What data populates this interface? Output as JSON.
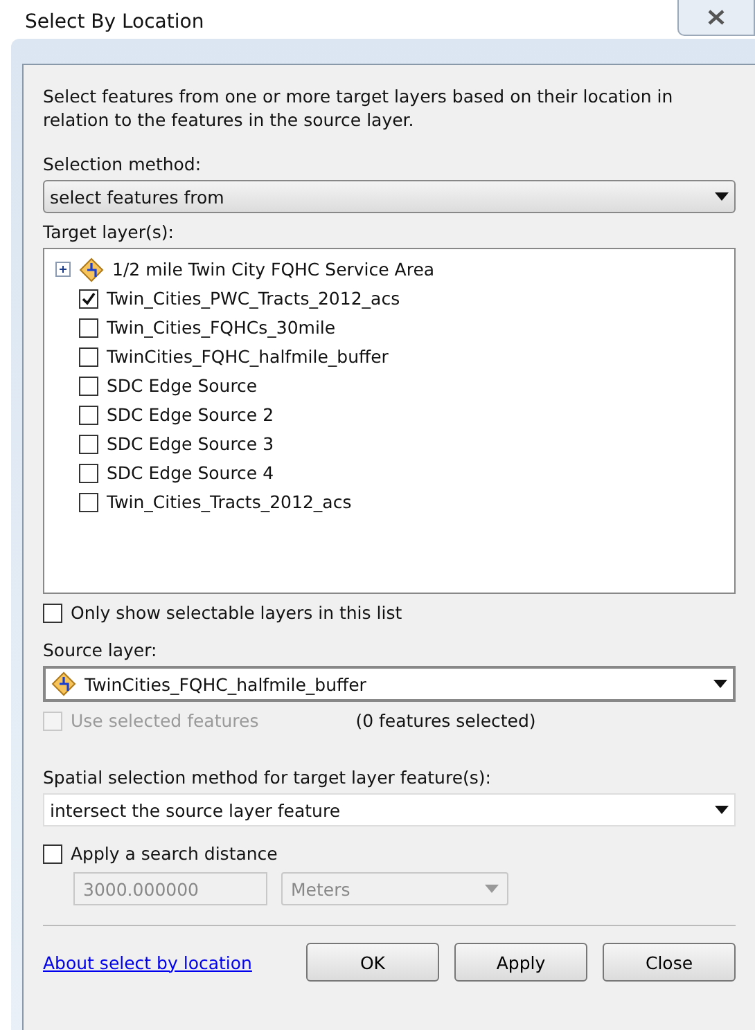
{
  "window": {
    "title": "Select By Location"
  },
  "description": "Select features from one or more target layers based on their location in relation to the features in the source layer.",
  "selection_method": {
    "label": "Selection method:",
    "value": "select features from"
  },
  "target_layers": {
    "label": "Target layer(s):",
    "items": [
      {
        "kind": "group",
        "name": "1/2 mile Twin City FQHC Service Area",
        "expanded": false
      },
      {
        "kind": "layer",
        "name": "Twin_Cities_PWC_Tracts_2012_acs",
        "checked": true
      },
      {
        "kind": "layer",
        "name": "Twin_Cities_FQHCs_30mile",
        "checked": false
      },
      {
        "kind": "layer",
        "name": "TwinCities_FQHC_halfmile_buffer",
        "checked": false
      },
      {
        "kind": "layer",
        "name": "SDC Edge Source",
        "checked": false
      },
      {
        "kind": "layer",
        "name": "SDC Edge Source 2",
        "checked": false
      },
      {
        "kind": "layer",
        "name": "SDC Edge Source 3",
        "checked": false
      },
      {
        "kind": "layer",
        "name": "SDC Edge Source 4",
        "checked": false
      },
      {
        "kind": "layer",
        "name": "Twin_Cities_Tracts_2012_acs",
        "checked": false
      }
    ]
  },
  "only_selectable": {
    "label": "Only show selectable layers in this list",
    "checked": false
  },
  "source_layer": {
    "label": "Source layer:",
    "value": "TwinCities_FQHC_halfmile_buffer"
  },
  "use_selected": {
    "label": "Use selected features",
    "checked": false,
    "disabled": true,
    "count": "(0 features selected)"
  },
  "spatial_method": {
    "label": "Spatial selection method for target layer feature(s):",
    "value": "intersect the source layer feature"
  },
  "search_distance": {
    "label": "Apply a search distance",
    "checked": false,
    "value": "3000.000000",
    "unit": "Meters",
    "disabled": true
  },
  "help_link": "About select by location",
  "buttons": [
    "OK",
    "Apply",
    "Close"
  ]
}
